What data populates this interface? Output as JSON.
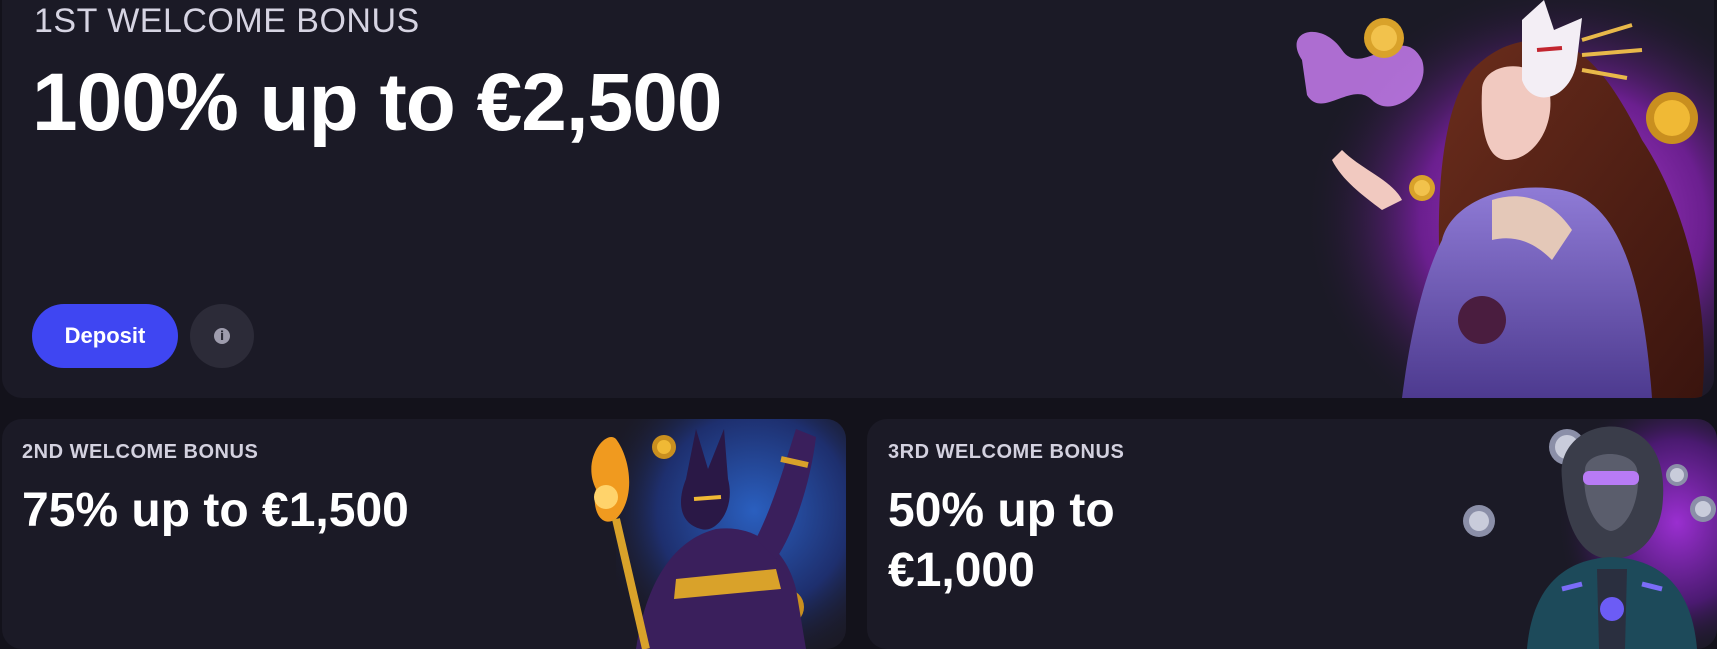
{
  "hero": {
    "eyebrow": "1ST WELCOME BONUS",
    "headline": "100% up to €2,500",
    "deposit_label": "Deposit",
    "info_icon": "info-icon"
  },
  "card2": {
    "eyebrow": "2ND WELCOME BONUS",
    "headline": "75% up to €1,500"
  },
  "card3": {
    "eyebrow": "3RD WELCOME BONUS",
    "headline": "50% up to €1,000"
  },
  "colors": {
    "page_bg": "#13121b",
    "card_bg": "#1b1a26",
    "accent_button": "#3f46f2",
    "info_button": "#2c2b38"
  }
}
